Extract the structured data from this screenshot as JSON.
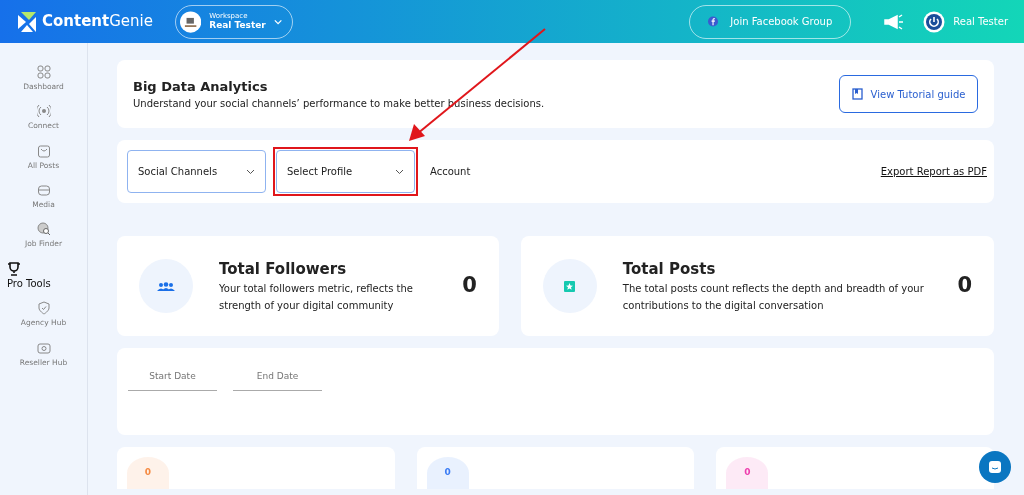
{
  "header": {
    "logo": "**Content**Genie",
    "workspace": {
      "label": "Workspace",
      "name": "Real Tester"
    },
    "facebook_button": "Join Facebook Group",
    "user": "Real Tester"
  },
  "sidebar": {
    "items": [
      {
        "label": "Dashboard",
        "kind": "link"
      },
      {
        "label": "Connect",
        "kind": "link"
      },
      {
        "label": "All Posts",
        "kind": "link"
      },
      {
        "label": "Media",
        "kind": "link"
      },
      {
        "label": "Job Finder",
        "kind": "link"
      },
      {
        "label": "Pro Tools",
        "kind": "section"
      },
      {
        "label": "Agency Hub",
        "kind": "link"
      },
      {
        "label": "Reseller Hub",
        "kind": "link"
      }
    ]
  },
  "intro": {
    "title": "Big Data Analytics",
    "subtitle": "Understand your social channels’ performance to make better business decisions.",
    "tutorial_button": "View Tutorial guide"
  },
  "filters": {
    "selects": [
      {
        "label": "Social Channels",
        "highlighted": false
      },
      {
        "label": "Select Profile",
        "highlighted": true
      }
    ],
    "account": "Account",
    "export_link": "Export Report as PDF"
  },
  "stats": [
    {
      "title": "Total Followers",
      "description": "Your total followers metric, reflects the strength of your digital community",
      "value": "0",
      "color": "#1a6fe8"
    },
    {
      "title": "Total Posts",
      "description": "The total posts count reflects the depth and breadth of your contributions to the digital conversation",
      "value": "0",
      "color": "#15c9b0"
    }
  ],
  "dates": [
    {
      "placeholder": "Start Date"
    },
    {
      "placeholder": "End Date"
    }
  ],
  "counters": [
    {
      "value": "0",
      "color": "#f58a42"
    },
    {
      "value": "0",
      "color": "#3b7cf5"
    },
    {
      "value": "0",
      "color": "#ee3fae"
    }
  ]
}
